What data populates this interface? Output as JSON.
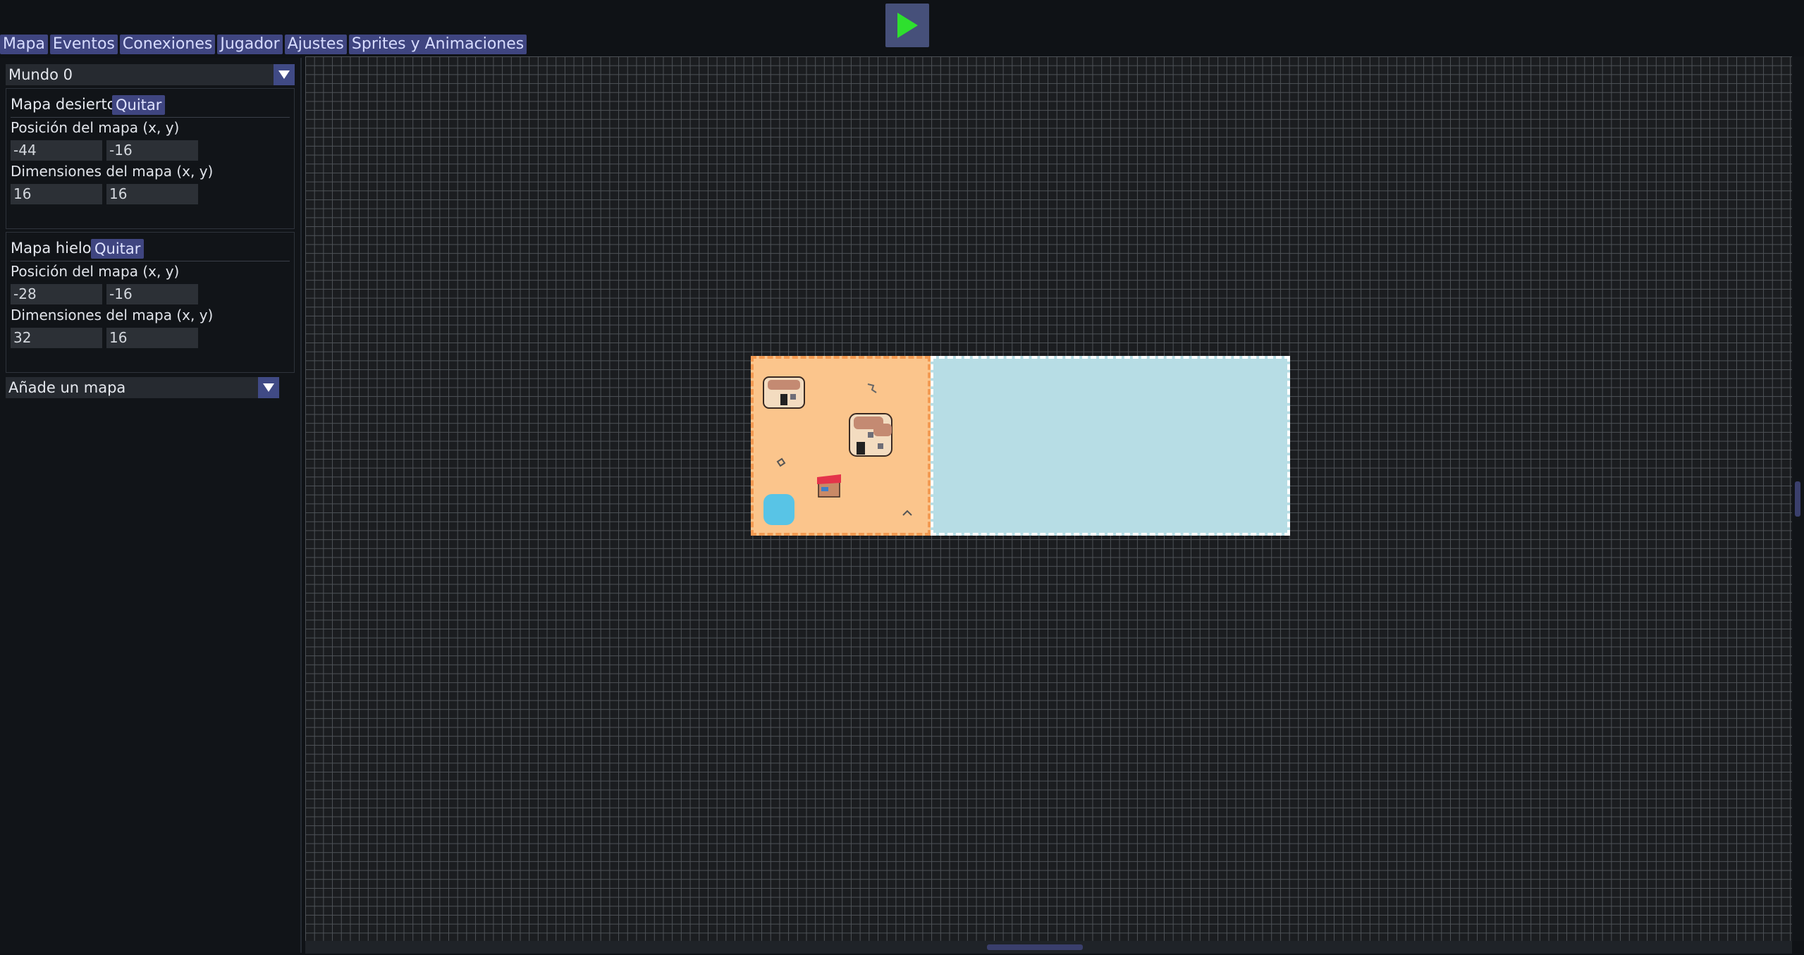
{
  "tabs": [
    "Mapa",
    "Eventos",
    "Conexiones",
    "Jugador",
    "Ajustes",
    "Sprites y Animaciones"
  ],
  "world_select": {
    "value": "Mundo 0"
  },
  "maps": [
    {
      "name": "Mapa desierto",
      "remove_label": "Quitar",
      "position_label": "Posición del mapa (x, y)",
      "position": [
        "-44",
        "-16"
      ],
      "dimensions_label": "Dimensiones del mapa (x, y)",
      "dimensions": [
        "16",
        "16"
      ]
    },
    {
      "name": "Mapa hielo",
      "remove_label": "Quitar",
      "position_label": "Posición del mapa (x, y)",
      "position": [
        "-28",
        "-16"
      ],
      "dimensions_label": "Dimensiones del mapa (x, y)",
      "dimensions": [
        "32",
        "16"
      ]
    }
  ],
  "add_map_select": {
    "value": "Añade un mapa"
  },
  "colors": {
    "accent": "#3f4580",
    "play_green": "#2ee02e",
    "desert": "#fbc58c",
    "ice": "#b7dde5",
    "grid_bg": "#1b1d20"
  },
  "icons": {
    "play": "play-icon",
    "dropdown": "triangle-down-icon"
  }
}
